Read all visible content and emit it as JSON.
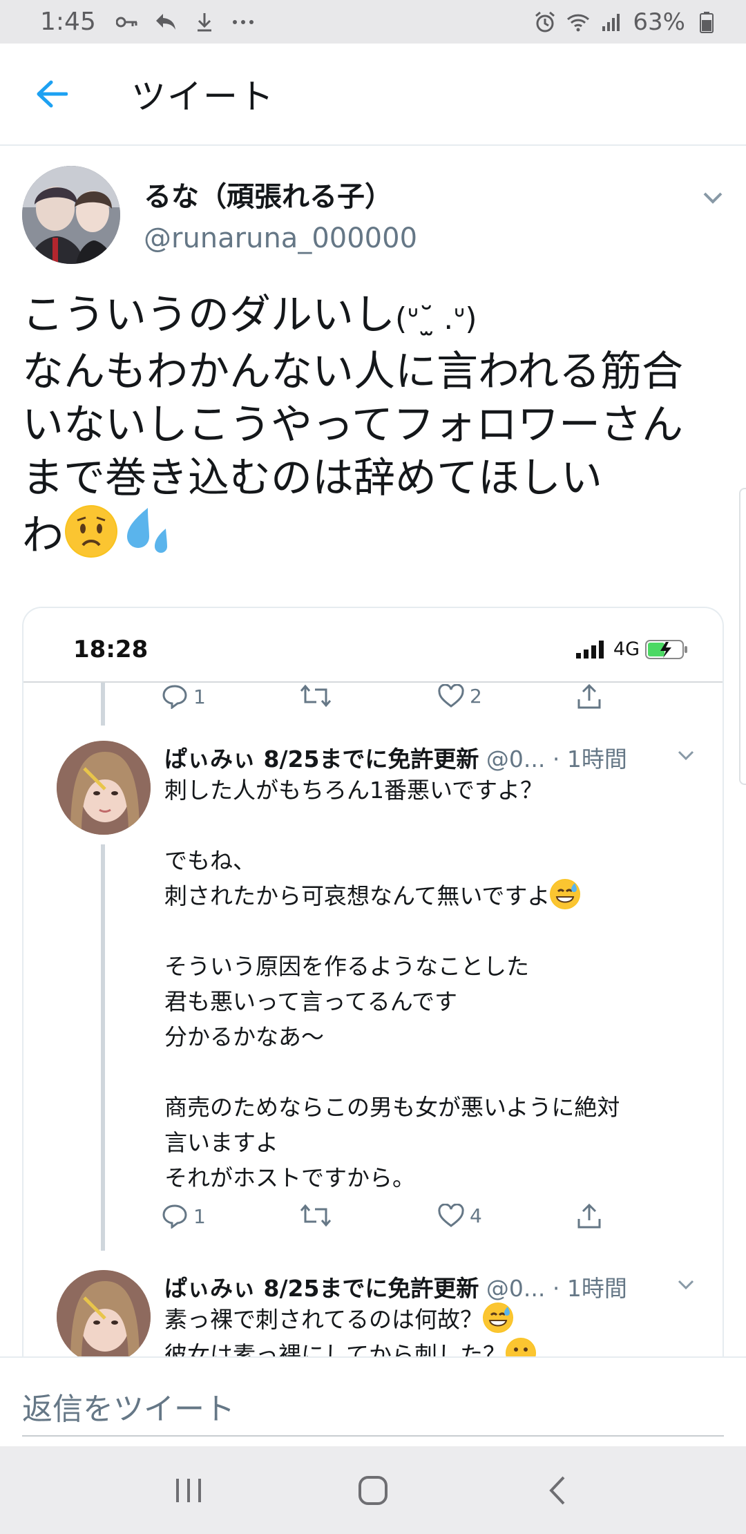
{
  "status_bar": {
    "time": "1:45",
    "battery": "63%"
  },
  "header": {
    "title": "ツイート"
  },
  "tweet": {
    "author_name": "るな（頑張れる子）",
    "author_handle": "@runaruna_000000",
    "text_line1": "こういうのダルいし",
    "kaomoji": "(ᐡ˘̫ .ᐡ)",
    "text_rest": "なんもわかんない人に言われる筋合\nいないしこうやってフォロワーさん\nまで巻き込むのは辞めてほしい\nわ"
  },
  "screenshot": {
    "time": "18:28",
    "network": "4G",
    "top_actions": {
      "replies": "1",
      "likes": "2"
    },
    "reply1": {
      "name": "ぱぃみぃ 8/25までに免許更新",
      "meta": " @0... · 1時間",
      "text_a": "刺した人がもちろん1番悪いですよ？\n\nでもね、\n刺されたから可哀想なんて無いですよ",
      "text_b": "\n\nそういう原因を作るようなことした\n君も悪いって言ってるんです\n分かるかなあ～\n\n商売のためならこの男も女が悪いように絶対\n言いますよ\nそれがホストですから。",
      "replies": "1",
      "likes": "4"
    },
    "reply2": {
      "name": "ぱぃみぃ 8/25までに免許更新",
      "meta": " @0... · 1時間",
      "text_line1": "素っ裸で刺されてるのは何故？",
      "text_line2": "彼女は素っ裸にしてから刺した？"
    }
  },
  "compose": {
    "placeholder": "返信をツイート"
  },
  "colors": {
    "accent": "#1da1f2",
    "text": "#14171a",
    "secondary": "#657786"
  },
  "icons": [
    "back-arrow-icon",
    "chevron-down-icon",
    "reply-icon",
    "retweet-icon",
    "like-icon",
    "share-icon",
    "recents-icon",
    "home-icon",
    "back-icon"
  ]
}
